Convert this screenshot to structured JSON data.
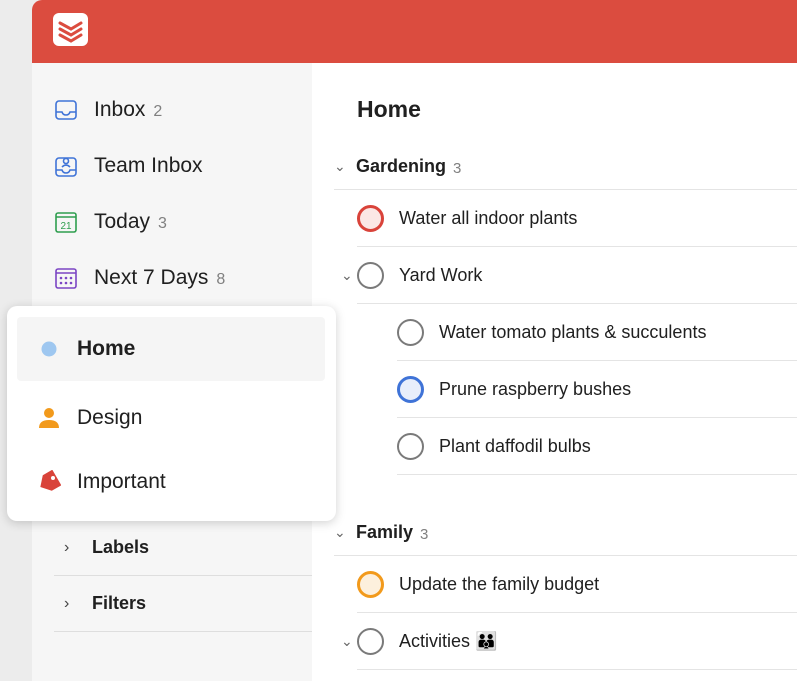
{
  "sidebar": {
    "nav": [
      {
        "label": "Inbox",
        "count": "2",
        "icon": "inbox-icon"
      },
      {
        "label": "Team Inbox",
        "count": "",
        "icon": "team-inbox-icon"
      },
      {
        "label": "Today",
        "count": "3",
        "icon": "calendar-today-icon",
        "icon_text": "21"
      },
      {
        "label": "Next 7 Days",
        "count": "8",
        "icon": "calendar-week-icon"
      }
    ],
    "sections": [
      {
        "label": "Labels"
      },
      {
        "label": "Filters"
      }
    ]
  },
  "popup": {
    "items": [
      {
        "label": "Home",
        "icon": "dot-icon",
        "color": "#9ec7f0"
      },
      {
        "label": "Design",
        "icon": "person-icon",
        "color": "#f29a1c"
      },
      {
        "label": "Important",
        "icon": "tag-icon",
        "color": "#d9433a"
      }
    ]
  },
  "main": {
    "title": "Home",
    "groups": [
      {
        "label": "Gardening",
        "count": "3",
        "tasks": [
          {
            "text": "Water all indoor plants",
            "priority": "p1"
          },
          {
            "text": "Yard Work",
            "priority": "none",
            "expandable": true
          },
          {
            "text": "Water tomato plants & succulents",
            "priority": "none",
            "sub": true
          },
          {
            "text": "Prune raspberry bushes",
            "priority": "p3",
            "sub": true
          },
          {
            "text": "Plant daffodil bulbs",
            "priority": "none",
            "sub": true
          }
        ]
      },
      {
        "label": "Family",
        "count": "3",
        "tasks": [
          {
            "text": "Update the family budget",
            "priority": "p2"
          },
          {
            "text": "Activities 👪",
            "priority": "none",
            "expandable": true
          }
        ]
      }
    ]
  },
  "colors": {
    "brand": "#db4c3f",
    "p1": "#d9433a",
    "p2": "#f29a1c",
    "p3": "#3f73d7"
  }
}
